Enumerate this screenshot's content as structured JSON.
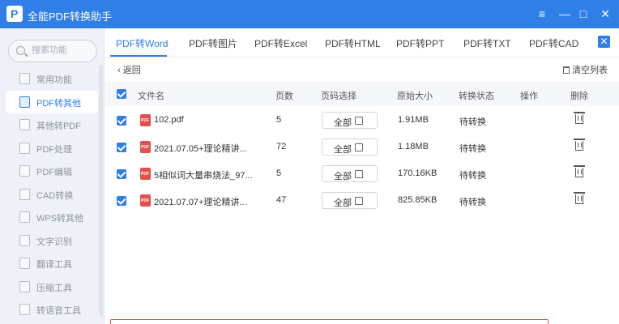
{
  "window": {
    "title": "全能PDF转换助手",
    "logo_letter": "P",
    "menu_icon": "≡",
    "minimize_icon": "—",
    "maximize_icon": "□",
    "close_icon": "✕"
  },
  "sidebar": {
    "search_placeholder": "搜索功能",
    "items": [
      {
        "label": "常用功能",
        "icon": "star-icon"
      },
      {
        "label": "PDF转其他",
        "icon": "pdf-convert-icon"
      },
      {
        "label": "其他转PDF",
        "icon": "to-pdf-icon"
      },
      {
        "label": "PDF处理",
        "icon": "pdf-process-icon"
      },
      {
        "label": "PDF编辑",
        "icon": "pdf-edit-icon"
      },
      {
        "label": "CAD转换",
        "icon": "cad-icon"
      },
      {
        "label": "WPS转其他",
        "icon": "wps-icon"
      },
      {
        "label": "文字识别",
        "icon": "ocr-icon"
      },
      {
        "label": "翻译工具",
        "icon": "translate-icon"
      },
      {
        "label": "压缩工具",
        "icon": "compress-icon"
      },
      {
        "label": "转语音工具",
        "icon": "voice-icon"
      }
    ],
    "active_index": 1
  },
  "tabs": [
    {
      "label": "PDF转Word"
    },
    {
      "label": "PDF转图片"
    },
    {
      "label": "PDF转Excel"
    },
    {
      "label": "PDF转HTML"
    },
    {
      "label": "PDF转PPT"
    },
    {
      "label": "PDF转TXT"
    },
    {
      "label": "PDF转CAD"
    }
  ],
  "active_tab": 0,
  "toolbar": {
    "back_label": "‹ 返回",
    "clear_label": "清空列表"
  },
  "table": {
    "headers": [
      "文件名",
      "页数",
      "页码选择",
      "原始大小",
      "转换状态",
      "操作",
      "删除"
    ],
    "rows": [
      {
        "name": "102.pdf",
        "pages": "5",
        "range": "全部",
        "size": "1.91MB",
        "status": "待转换",
        "checked": true
      },
      {
        "name": "2021.07.05+理论精讲...",
        "pages": "72",
        "range": "全部",
        "size": "1.18MB",
        "status": "待转换",
        "checked": true
      },
      {
        "name": "5相似词大量串烧法_97...",
        "pages": "5",
        "range": "全部",
        "size": "170.16KB",
        "status": "待转换",
        "checked": true
      },
      {
        "name": "2021.07.07+理论精讲...",
        "pages": "47",
        "range": "全部",
        "size": "825.85KB",
        "status": "待转换",
        "checked": true
      }
    ]
  },
  "colors": {
    "accent": "#2f7fe6",
    "pdf_red": "#e44f4a"
  }
}
